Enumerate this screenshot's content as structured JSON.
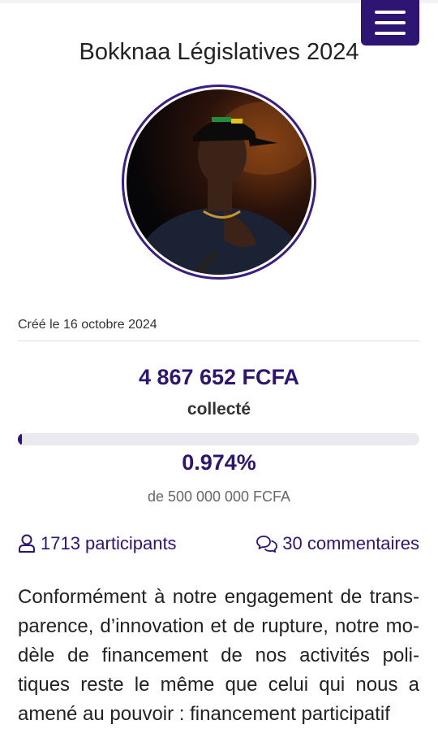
{
  "page": {
    "title": "Bokknaa Législatives 2024"
  },
  "campaign": {
    "created_label": "Créé le 16 octobre 2024",
    "amount_collected": "4 867 652 FCFA",
    "collected_label": "collecté",
    "progress_fraction": 0.00974,
    "percent_text": "0.974%",
    "goal_text": "de 500 000 000 FCFA",
    "participants_text": "1713 participants",
    "comments_text": "30 commentaires",
    "description": "Conformément à notre engagement de trans­parence, d’innovation et de rupture, notre mo­dèle de financement de nos activités poli­tiques reste le même que celui qui nous a amené au pouvoir : financement participatif"
  },
  "colors": {
    "brand": "#2e1574",
    "progress_track": "#e9e9ef"
  },
  "icons": {
    "menu": "hamburger-menu-icon",
    "participants": "user-icon",
    "comments": "comments-icon"
  }
}
